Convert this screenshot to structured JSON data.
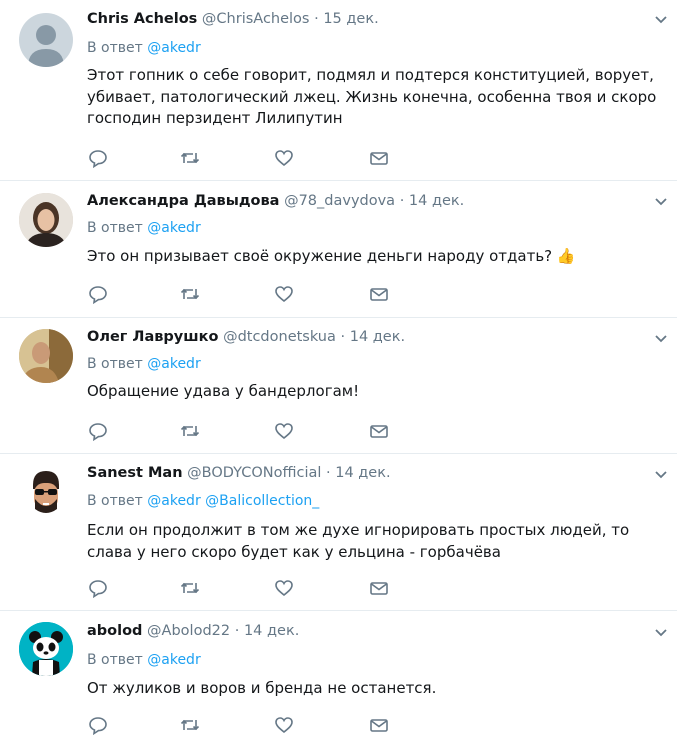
{
  "reply_prefix": "В ответ",
  "colors": {
    "accent": "#1da1f2",
    "secondary": "#657786",
    "text": "#14171a",
    "divider": "#e6ecf0"
  },
  "icons": [
    "reply-icon",
    "retweet-icon",
    "like-icon",
    "dm-icon",
    "chevron-down-icon"
  ],
  "tweets": [
    {
      "name": "Chris Achelos",
      "handle": "@ChrisAchelos",
      "dot": "·",
      "date": "15 дек.",
      "mentions": [
        "@akedr"
      ],
      "text": "Этот гопник о себе говорит, подмял и подтерся конституцией, ворует, убивает, патологический лжец. Жизнь конечна, особенна твоя и скоро господин перзидент Лилипутин",
      "avatar": "default-avatar"
    },
    {
      "name": "Александра Давыдова",
      "handle": "@78_davydova",
      "dot": "·",
      "date": "14 дек.",
      "mentions": [
        "@akedr"
      ],
      "text": "Это он призывает своё окружение деньги народу отдать?",
      "emoji": "👍",
      "avatar": "photo-avatar"
    },
    {
      "name": "Олег Лаврушко",
      "handle": "@dtcdonetskua",
      "dot": "·",
      "date": "14 дек.",
      "mentions": [
        "@akedr"
      ],
      "text": "Обращение удава у бандерлогам!",
      "avatar": "photo-avatar"
    },
    {
      "name": "Sanest Man",
      "handle": "@BODYCONofficial",
      "dot": "·",
      "date": "14 дек.",
      "mentions": [
        "@akedr",
        "@Balicollection_"
      ],
      "text": "Если он продолжит в том же духе игнорировать простых людей, то слава у него скоро будет как у ельцина - горбачёва",
      "avatar": "cartoon-avatar"
    },
    {
      "name": "abolod",
      "handle": "@Abolod22",
      "dot": "·",
      "date": "14 дек.",
      "mentions": [
        "@akedr"
      ],
      "text": "От жуликов и воров и бренда не останется.",
      "avatar": "panda-avatar"
    }
  ]
}
